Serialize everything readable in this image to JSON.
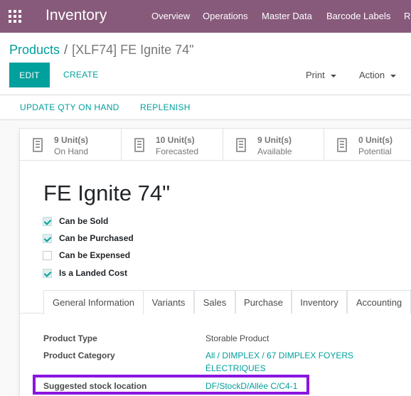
{
  "navbar": {
    "brand": "Inventory",
    "menu": [
      "Overview",
      "Operations",
      "Master Data",
      "Barcode Labels",
      "R"
    ]
  },
  "breadcrumb": {
    "parent": "Products",
    "separator": "/",
    "current": "[XLF74] FE Ignite 74\""
  },
  "toolbar": {
    "edit_label": "EDIT",
    "create_label": "CREATE",
    "print_label": "Print",
    "action_label": "Action"
  },
  "actions": {
    "update_qty": "UPDATE QTY ON HAND",
    "replenish": "REPLENISH"
  },
  "stats": [
    {
      "value": "9 Unit(s)",
      "label": "On Hand"
    },
    {
      "value": "10 Unit(s)",
      "label": "Forecasted"
    },
    {
      "value": "9 Unit(s)",
      "label": "Available"
    },
    {
      "value": "0 Unit(s)",
      "label": "Potential"
    }
  ],
  "product": {
    "name": "FE Ignite 74\"",
    "checkboxes": [
      {
        "label": "Can be Sold",
        "checked": true
      },
      {
        "label": "Can be Purchased",
        "checked": true
      },
      {
        "label": "Can be Expensed",
        "checked": false
      },
      {
        "label": "Is a Landed Cost",
        "checked": true
      }
    ]
  },
  "tabs": [
    "General Information",
    "Variants",
    "Sales",
    "Purchase",
    "Inventory",
    "Accounting"
  ],
  "fields": [
    {
      "label": "Product Type",
      "value": "Storable Product"
    },
    {
      "label": "Product Category",
      "value_line1": "All / DIMPLEX / 67 DIMPLEX FOYERS",
      "value_line2": "ÉLECTRIQUES"
    },
    {
      "label": "Suggested stock location",
      "value": "DF/StockD/Allée C/C4-1"
    }
  ],
  "colors": {
    "navbar": "#875a7b",
    "accent": "#00a09d",
    "highlight": "#8a16e0"
  }
}
